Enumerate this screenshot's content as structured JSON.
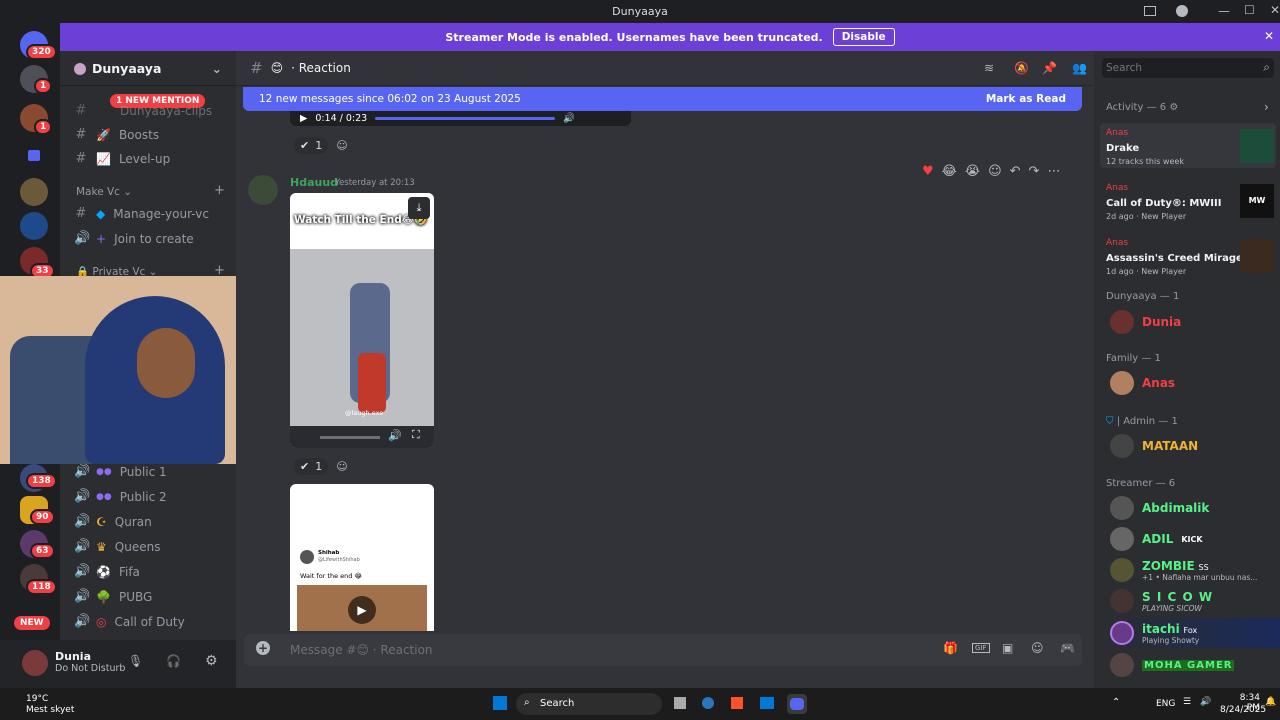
{
  "window": {
    "title": "Dunyaaya"
  },
  "banner": {
    "text": "Streamer Mode is enabled. Usernames have been truncated.",
    "button": "Disable"
  },
  "servers": {
    "badges": [
      "320",
      "1",
      "1",
      "33",
      "138",
      "90",
      "63",
      "118"
    ],
    "new_label": "NEW"
  },
  "sidebar": {
    "server_name": "Dunyaaya",
    "mention_pill": "1 NEW MENTION",
    "channels_top": [
      {
        "icon": "#",
        "label": "Dunyaaya-clips"
      },
      {
        "icon": "#",
        "label": "Boosts"
      },
      {
        "icon": "#",
        "label": "Level-up"
      }
    ],
    "cat_make_vc": "Make Vc",
    "make_vc": [
      {
        "icon": "#",
        "label": "Manage-your-vc"
      },
      {
        "icon": "🔊",
        "label": "Join to create"
      }
    ],
    "cat_private": "Private Vc",
    "voice": [
      {
        "label": "Public 1"
      },
      {
        "label": "Public 2"
      },
      {
        "label": "Quran"
      },
      {
        "label": "Queens"
      },
      {
        "label": "Fifa"
      },
      {
        "label": "PUBG"
      },
      {
        "label": "Call of Duty"
      }
    ]
  },
  "user": {
    "name": "Dunia",
    "status": "Do Not Disturb"
  },
  "chat": {
    "channel": "· Reaction",
    "new_messages": "12 new messages since 06:02 on 23 August 2025",
    "mark_read": "Mark as Read",
    "audio_time": "0:14 / 0:23",
    "reaction_count_1": "1",
    "msg_author": "Hdauud",
    "msg_time": "Yesterday at 20:13",
    "video_caption": "Watch Till the End😂🤣",
    "video_watermark": "@laugh.exe",
    "reaction_count_2": "1",
    "tweet_name": "Shihab",
    "tweet_handle": "@LifewithShihab",
    "tweet_text": "Wait for the end 😂",
    "input_placeholder": "Message #😊 · Reaction"
  },
  "search": {
    "placeholder": "Search"
  },
  "members": {
    "activity_header": "Activity — 6",
    "activities": [
      {
        "user": "Anas",
        "title": "Drake",
        "sub": "12 tracks this week"
      },
      {
        "user": "Anas",
        "title": "Call of Duty®: MWIII",
        "sub": "2d ago  ·  New Player"
      },
      {
        "user": "Anas",
        "title": "Assassin's Creed Mirage",
        "sub": "1d ago  ·  New Player"
      }
    ],
    "group_dunyaaya": "Dunyaaya — 1",
    "dunia": "Dunia",
    "group_family": "Family — 1",
    "anas": "Anas",
    "group_admin": "| Admin — 1",
    "mataan": "MATAAN",
    "group_streamer": "Streamer — 6",
    "streamers": [
      {
        "name": "Abdimalik",
        "tag": "",
        "sub": ""
      },
      {
        "name": "ADIL",
        "tag": "KICK",
        "sub": ""
      },
      {
        "name": "ZOMBIE",
        "tag": "SS",
        "sub": "+1 • Naflaha mar unbuu nas..."
      },
      {
        "name": "S I C O W",
        "tag": "",
        "sub": "PLAYING SICOW"
      },
      {
        "name": "itachi",
        "tag": "Fox",
        "sub": "Playing Showty"
      },
      {
        "name": "MOHA GAMER",
        "tag": "",
        "sub": ""
      }
    ],
    "colors": {
      "anas": "#f23f43",
      "green": "#3ba55c",
      "yellow": "#f0b232",
      "lime": "#57f287"
    }
  },
  "taskbar": {
    "weather_temp": "19°C",
    "weather_desc": "Mest skyet",
    "search": "Search",
    "lang": "ENG",
    "time": "8:34 PM",
    "date": "8/24/2025"
  }
}
